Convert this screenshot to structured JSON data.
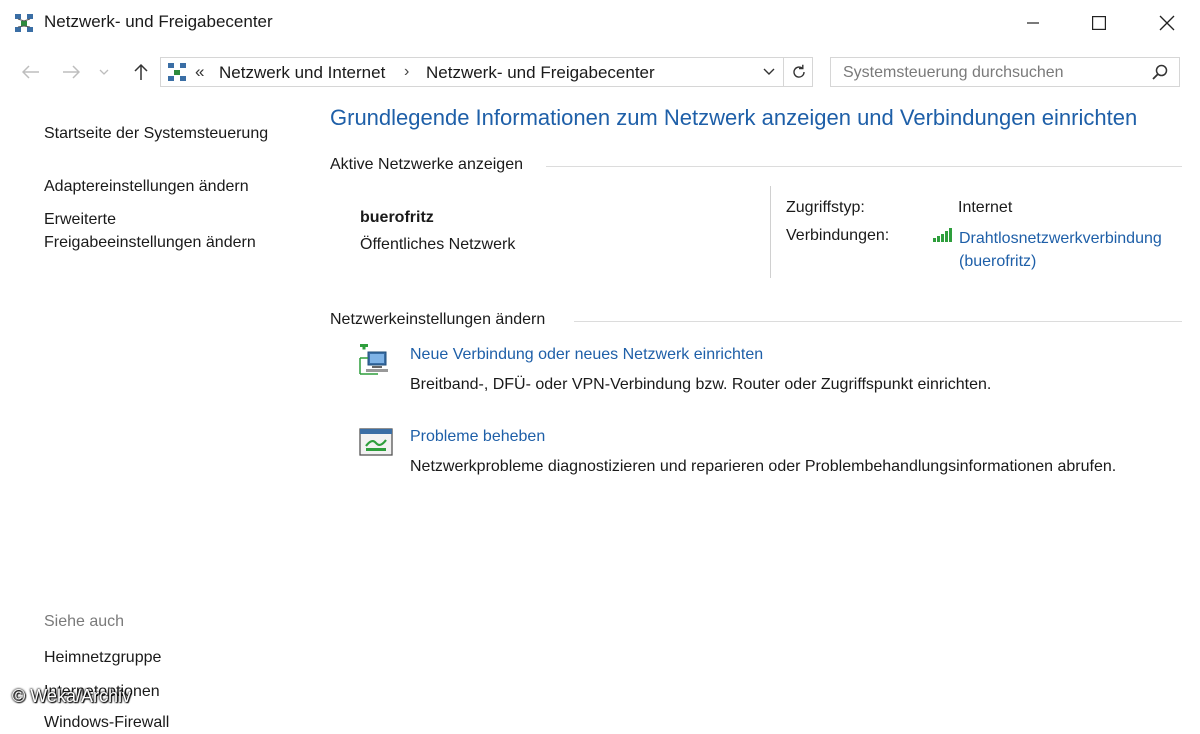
{
  "window": {
    "title": "Netzwerk- und Freigabecenter"
  },
  "address_bar": {
    "chevron": "«",
    "crumbs": [
      "Netzwerk und Internet",
      "Netzwerk- und Freigabecenter"
    ],
    "separator": "›"
  },
  "search": {
    "placeholder": "Systemsteuerung durchsuchen"
  },
  "sidebar": {
    "home": "Startseite der Systemsteuerung",
    "adapter": "Adaptereinstellungen ändern",
    "advanced_line1": "Erweiterte",
    "advanced_line2": "Freigabeeinstellungen ändern",
    "see_also": "Siehe auch",
    "see_also_items": [
      "Heimnetzgruppe",
      "Internetoptionen",
      "Windows-Firewall"
    ]
  },
  "main": {
    "title": "Grundlegende Informationen zum Netzwerk anzeigen und Verbindungen einrichten",
    "active_networks_heading": "Aktive Netzwerke anzeigen",
    "network": {
      "name": "buerofritz",
      "type": "Öffentliches Netzwerk",
      "access_label": "Zugriffstyp:",
      "access_value": "Internet",
      "connections_label": "Verbindungen:",
      "connection_link_line1": "Drahtlosnetzwerkverbindung",
      "connection_link_line2": "(buerofritz)"
    },
    "settings_heading": "Netzwerkeinstellungen ändern",
    "tasks": [
      {
        "link": "Neue Verbindung oder neues Netzwerk einrichten",
        "desc": "Breitband-, DFÜ- oder VPN-Verbindung bzw. Router oder Zugriffspunkt einrichten."
      },
      {
        "link": "Probleme beheben",
        "desc": "Netzwerkprobleme diagnostizieren und reparieren oder Problembehandlungsinformationen abrufen."
      }
    ]
  },
  "watermark": "© Weka/Archiv",
  "colors": {
    "link": "#1e5fa8",
    "title": "#1e5fa8",
    "muted": "#7a7a7a"
  }
}
